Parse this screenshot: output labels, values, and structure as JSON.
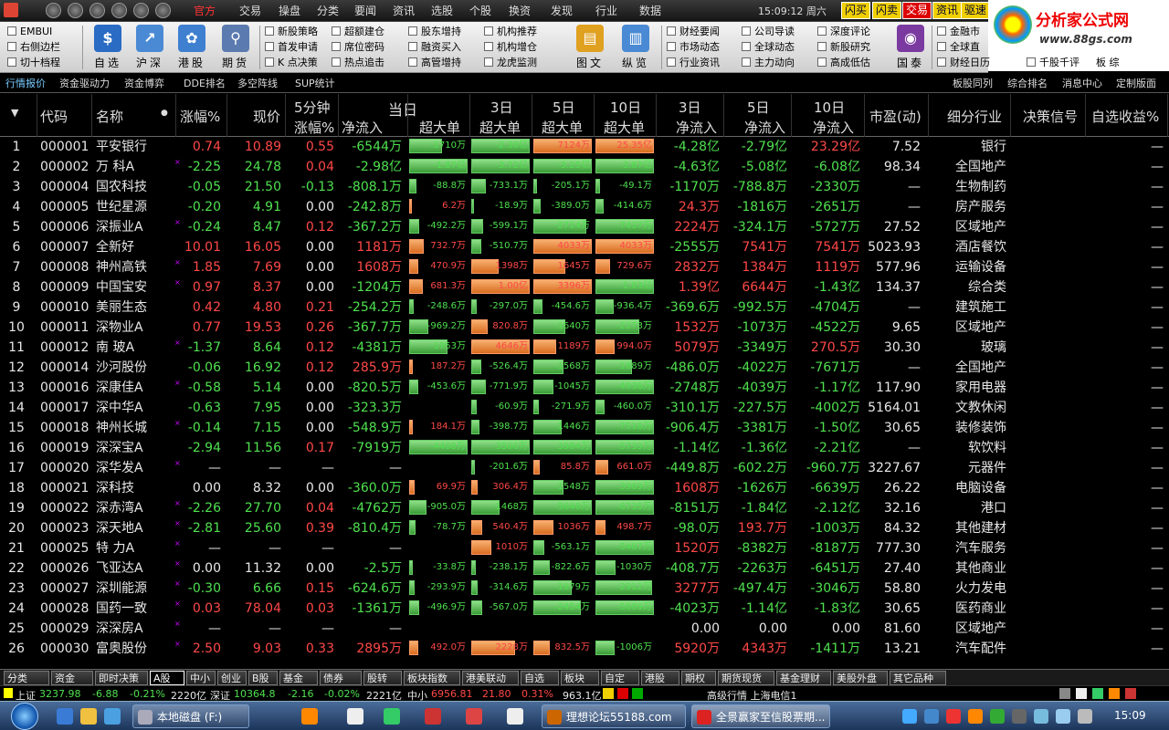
{
  "menubar": {
    "items": [
      "官方",
      "交易",
      "操盘",
      "分类",
      "要闻",
      "资讯",
      "选股",
      "个股",
      "换资",
      "发现",
      "行业",
      "数据"
    ],
    "time": "15:09:12",
    "weekday": "周六",
    "buttons": [
      "闪买",
      "闪卖",
      "交易",
      "资讯",
      "驱速"
    ]
  },
  "logo": {
    "title": "分析家公式网",
    "url": "www.88gs.com"
  },
  "toolbar": {
    "checks_left": [
      "EMBUI",
      "右侧边栏",
      "切十档程"
    ],
    "big_left": [
      {
        "icon": "$",
        "label": "自选"
      },
      {
        "icon": "↗",
        "label": "沪深"
      },
      {
        "icon": "✿",
        "label": "港股"
      },
      {
        "icon": "⚲",
        "label": "期货"
      }
    ],
    "check_cols": [
      [
        "新股策略",
        "首发申请",
        "K 点决策"
      ],
      [
        "超额建仓",
        "席位密码",
        "热点追击"
      ],
      [
        "股东增持",
        "融资买入",
        "高管增持"
      ],
      [
        "机构推荐",
        "机构增仓",
        "龙虎监测"
      ]
    ],
    "big_mid": [
      {
        "icon": "▤",
        "label": "图文"
      },
      {
        "icon": "▥",
        "label": "纵览"
      }
    ],
    "check_cols2": [
      [
        "财经要闻",
        "市场动态",
        "行业资讯"
      ],
      [
        "公司导读",
        "全球动态",
        "主力动向"
      ],
      [
        "深度评论",
        "新股研究",
        "高成低估"
      ]
    ],
    "big_right": {
      "icon": "◉",
      "label": "国泰"
    },
    "check_cols3": [
      [
        "金融市",
        "全球直",
        "财经日历"
      ],
      [
        "",
        "",
        "千股千评"
      ]
    ],
    "tail": "板 综"
  },
  "subtabs": [
    "行情报价",
    "资金驱动力",
    "资金博弈",
    "DDE排名",
    "多空阵线",
    "SUP统计"
  ],
  "subtabs_right": [
    "板股同列",
    "综合排名",
    "消息中心",
    "定制版面"
  ],
  "header": {
    "code": "代码",
    "name": "名称",
    "chg": "涨幅%",
    "price": "现价",
    "min5_top": "5分钟",
    "min5_bot": "涨幅%",
    "today": "当日",
    "d3": "3日",
    "d5": "5日",
    "d10": "10日",
    "netin": "净流入",
    "huge": "超大单",
    "pe": "市盈(动)",
    "industry": "细分行业",
    "signal": "决策信号",
    "selfgain": "自选收益%"
  },
  "stocks": [
    {
      "no": "1",
      "code": "000001",
      "name": "平安银行",
      "mark": "",
      "chg": "0.74",
      "price": "10.89",
      "m5": "0.55",
      "netin": "-6544万",
      "b1": "-1710万",
      "b2": "-2.30亿",
      "b3": "7124万",
      "b4": "25.35亿",
      "n3": "-4.28亿",
      "n5": "-2.79亿",
      "n10": "23.29亿",
      "pe": "7.52",
      "ind": "银行",
      "sg": "—"
    },
    {
      "no": "2",
      "code": "000002",
      "name": "万 科A",
      "mark": "×",
      "chg": "-2.25",
      "price": "24.78",
      "m5": "0.04",
      "netin": "-2.98亿",
      "b1": "-1.87亿",
      "b2": "-3.72亿",
      "b3": "-3.25亿",
      "b4": "-3.87亿",
      "n3": "-4.63亿",
      "n5": "-5.08亿",
      "n10": "-6.08亿",
      "pe": "98.34",
      "ind": "全国地产",
      "sg": "—"
    },
    {
      "no": "3",
      "code": "000004",
      "name": "国农科技",
      "mark": "",
      "chg": "-0.05",
      "price": "21.50",
      "m5": "-0.13",
      "netin": "-808.1万",
      "b1": "-88.8万",
      "b2": "-733.1万",
      "b3": "-205.1万",
      "b4": "-49.1万",
      "n3": "-1170万",
      "n5": "-788.8万",
      "n10": "-2330万",
      "pe": "—",
      "ind": "生物制药",
      "sg": "—"
    },
    {
      "no": "4",
      "code": "000005",
      "name": "世纪星源",
      "mark": "",
      "chg": "-0.20",
      "price": "4.91",
      "m5": "0.00",
      "netin": "-242.8万",
      "b1": "6.2万",
      "b2": "-18.9万",
      "b3": "-389.0万",
      "b4": "-414.6万",
      "n3": "24.3万",
      "n5": "-1816万",
      "n10": "-2651万",
      "pe": "—",
      "ind": "房产服务",
      "sg": "—"
    },
    {
      "no": "5",
      "code": "000006",
      "name": "深振业A",
      "mark": "×",
      "chg": "-0.24",
      "price": "8.47",
      "m5": "0.12",
      "netin": "-367.2万",
      "b1": "-492.2万",
      "b2": "-599.1万",
      "b3": "-2714万",
      "b4": "-7437万",
      "n3": "2224万",
      "n5": "-324.1万",
      "n10": "-5727万",
      "pe": "27.52",
      "ind": "区域地产",
      "sg": "—"
    },
    {
      "no": "6",
      "code": "000007",
      "name": "全新好",
      "mark": "",
      "chg": "10.01",
      "price": "16.05",
      "m5": "0.00",
      "netin": "1181万",
      "b1": "732.7万",
      "b2": "-510.7万",
      "b3": "4033万",
      "b4": "4033万",
      "n3": "-2555万",
      "n5": "7541万",
      "n10": "7541万",
      "pe": "5023.93",
      "ind": "酒店餐饮",
      "sg": "—"
    },
    {
      "no": "7",
      "code": "000008",
      "name": "神州高铁",
      "mark": "×",
      "chg": "1.85",
      "price": "7.69",
      "m5": "0.00",
      "netin": "1608万",
      "b1": "470.9万",
      "b2": "1398万",
      "b3": "1645万",
      "b4": "729.6万",
      "n3": "2832万",
      "n5": "1384万",
      "n10": "1119万",
      "pe": "577.96",
      "ind": "运输设备",
      "sg": "—"
    },
    {
      "no": "8",
      "code": "000009",
      "name": "中国宝安",
      "mark": "×",
      "chg": "0.97",
      "price": "8.37",
      "m5": "0.00",
      "netin": "-1204万",
      "b1": "681.3万",
      "b2": "1.00亿",
      "b3": "3396万",
      "b4": "-1.03亿",
      "n3": "1.39亿",
      "n5": "6644万",
      "n10": "-1.43亿",
      "pe": "134.37",
      "ind": "综合类",
      "sg": "—"
    },
    {
      "no": "9",
      "code": "000010",
      "name": "美丽生态",
      "mark": "",
      "chg": "0.42",
      "price": "4.80",
      "m5": "0.21",
      "netin": "-254.2万",
      "b1": "-248.6万",
      "b2": "-297.0万",
      "b3": "-454.6万",
      "b4": "-936.4万",
      "n3": "-369.6万",
      "n5": "-992.5万",
      "n10": "-4704万",
      "pe": "—",
      "ind": "建筑施工",
      "sg": "—"
    },
    {
      "no": "10",
      "code": "000011",
      "name": "深物业A",
      "mark": "",
      "chg": "0.77",
      "price": "19.53",
      "m5": "0.26",
      "netin": "-367.7万",
      "b1": "-969.2万",
      "b2": "820.8万",
      "b3": "-1640万",
      "b4": "-2273万",
      "n3": "1532万",
      "n5": "-1073万",
      "n10": "-4522万",
      "pe": "9.65",
      "ind": "区域地产",
      "sg": "—"
    },
    {
      "no": "11",
      "code": "000012",
      "name": "南 玻A",
      "mark": "×",
      "chg": "-1.37",
      "price": "8.64",
      "m5": "0.12",
      "netin": "-4381万",
      "b1": "-1953万",
      "b2": "4646万",
      "b3": "1189万",
      "b4": "994.0万",
      "n3": "5079万",
      "n5": "-3349万",
      "n10": "270.5万",
      "pe": "30.30",
      "ind": "玻璃",
      "sg": "—"
    },
    {
      "no": "12",
      "code": "000014",
      "name": "沙河股份",
      "mark": "",
      "chg": "-0.06",
      "price": "16.92",
      "m5": "0.12",
      "netin": "285.9万",
      "b1": "187.2万",
      "b2": "-526.4万",
      "b3": "-1568万",
      "b4": "-1889万",
      "n3": "-486.0万",
      "n5": "-4022万",
      "n10": "-7671万",
      "pe": "—",
      "ind": "全国地产",
      "sg": "—"
    },
    {
      "no": "13",
      "code": "000016",
      "name": "深康佳A",
      "mark": "×",
      "chg": "-0.58",
      "price": "5.14",
      "m5": "0.00",
      "netin": "-820.5万",
      "b1": "-453.6万",
      "b2": "-771.9万",
      "b3": "-1045万",
      "b4": "-4938万",
      "n3": "-2748万",
      "n5": "-4039万",
      "n10": "-1.17亿",
      "pe": "117.90",
      "ind": "家用电器",
      "sg": "—"
    },
    {
      "no": "14",
      "code": "000017",
      "name": "深中华A",
      "mark": "",
      "chg": "-0.63",
      "price": "7.95",
      "m5": "0.00",
      "netin": "-323.3万",
      "b1": "",
      "b2": "-60.9万",
      "b3": "-271.9万",
      "b4": "-460.0万",
      "n3": "-310.1万",
      "n5": "-227.5万",
      "n10": "-4002万",
      "pe": "5164.01",
      "ind": "文教休闲",
      "sg": "—"
    },
    {
      "no": "15",
      "code": "000018",
      "name": "神州长城",
      "mark": "×",
      "chg": "-0.14",
      "price": "7.15",
      "m5": "0.00",
      "netin": "-548.9万",
      "b1": "184.1万",
      "b2": "-398.7万",
      "b3": "-1446万",
      "b4": "-7518万",
      "n3": "-906.4万",
      "n5": "-3381万",
      "n10": "-1.50亿",
      "pe": "30.65",
      "ind": "装修装饰",
      "sg": "—"
    },
    {
      "no": "16",
      "code": "000019",
      "name": "深深宝A",
      "mark": "",
      "chg": "-2.94",
      "price": "11.56",
      "m5": "0.17",
      "netin": "-7919万",
      "b1": "-4408万",
      "b2": "-3500万",
      "b3": "-3984万",
      "b4": "-5739万",
      "n3": "-1.14亿",
      "n5": "-1.36亿",
      "n10": "-2.21亿",
      "pe": "—",
      "ind": "软饮料",
      "sg": "—"
    },
    {
      "no": "17",
      "code": "000020",
      "name": "深华发A",
      "mark": "×",
      "chg": "—",
      "price": "—",
      "m5": "—",
      "netin": "—",
      "b1": "",
      "b2": "-201.6万",
      "b3": "85.8万",
      "b4": "661.0万",
      "n3": "-449.8万",
      "n5": "-602.2万",
      "n10": "-960.7万",
      "pe": "3227.67",
      "ind": "元器件",
      "sg": "—"
    },
    {
      "no": "18",
      "code": "000021",
      "name": "深科技",
      "mark": "",
      "chg": "0.00",
      "price": "8.32",
      "m5": "0.00",
      "netin": "-360.0万",
      "b1": "69.9万",
      "b2": "306.4万",
      "b3": "-1548万",
      "b4": "-3909万",
      "n3": "1608万",
      "n5": "-1626万",
      "n10": "-6639万",
      "pe": "26.22",
      "ind": "电脑设备",
      "sg": "—"
    },
    {
      "no": "19",
      "code": "000022",
      "name": "深赤湾A",
      "mark": "×",
      "chg": "-2.26",
      "price": "27.70",
      "m5": "0.04",
      "netin": "-4762万",
      "b1": "-905.0万",
      "b2": "-1468万",
      "b3": "-5648万",
      "b4": "-6735万",
      "n3": "-8151万",
      "n5": "-1.84亿",
      "n10": "-2.12亿",
      "pe": "32.16",
      "ind": "港口",
      "sg": "—"
    },
    {
      "no": "20",
      "code": "000023",
      "name": "深天地A",
      "mark": "×",
      "chg": "-2.81",
      "price": "25.60",
      "m5": "0.39",
      "netin": "-810.4万",
      "b1": "-78.7万",
      "b2": "540.4万",
      "b3": "1036万",
      "b4": "498.7万",
      "n3": "-98.0万",
      "n5": "193.7万",
      "n10": "-1003万",
      "pe": "84.32",
      "ind": "其他建材",
      "sg": "—"
    },
    {
      "no": "21",
      "code": "000025",
      "name": "特 力A",
      "mark": "×",
      "chg": "—",
      "price": "—",
      "m5": "—",
      "netin": "—",
      "b1": "",
      "b2": "1010万",
      "b3": "-563.1万",
      "b4": "-5407万",
      "n3": "1520万",
      "n5": "-8382万",
      "n10": "-8187万",
      "pe": "777.30",
      "ind": "汽车服务",
      "sg": "—"
    },
    {
      "no": "22",
      "code": "000026",
      "name": "飞亚达A",
      "mark": "×",
      "chg": "0.00",
      "price": "11.32",
      "m5": "0.00",
      "netin": "-2.5万",
      "b1": "-33.8万",
      "b2": "-238.1万",
      "b3": "-822.6万",
      "b4": "-1030万",
      "n3": "-408.7万",
      "n5": "-2263万",
      "n10": "-6451万",
      "pe": "27.40",
      "ind": "其他商业",
      "sg": "—"
    },
    {
      "no": "23",
      "code": "000027",
      "name": "深圳能源",
      "mark": "×",
      "chg": "-0.30",
      "price": "6.66",
      "m5": "0.15",
      "netin": "-624.6万",
      "b1": "-293.9万",
      "b2": "-314.6万",
      "b3": "-1979万",
      "b4": "-2912万",
      "n3": "3277万",
      "n5": "-497.4万",
      "n10": "-3046万",
      "pe": "58.80",
      "ind": "火力发电",
      "sg": "—"
    },
    {
      "no": "24",
      "code": "000028",
      "name": "国药一致",
      "mark": "×",
      "chg": "0.03",
      "price": "78.04",
      "m5": "0.03",
      "netin": "-1361万",
      "b1": "-496.9万",
      "b2": "-567.0万",
      "b3": "-2454万",
      "b4": "-5609万",
      "n3": "-4023万",
      "n5": "-1.14亿",
      "n10": "-1.83亿",
      "pe": "30.65",
      "ind": "医药商业",
      "sg": "—"
    },
    {
      "no": "25",
      "code": "000029",
      "name": "深深房A",
      "mark": "×",
      "chg": "—",
      "price": "—",
      "m5": "—",
      "netin": "—",
      "b1": "",
      "b2": "",
      "b3": "",
      "b4": "",
      "n3": "0.00",
      "n5": "0.00",
      "n10": "0.00",
      "pe": "81.60",
      "ind": "区域地产",
      "sg": "—"
    },
    {
      "no": "26",
      "code": "000030",
      "name": "富奥股份",
      "mark": "×",
      "chg": "2.50",
      "price": "9.03",
      "m5": "0.33",
      "netin": "2895万",
      "b1": "492.0万",
      "b2": "2228万",
      "b3": "832.5万",
      "b4": "-1006万",
      "n3": "5920万",
      "n5": "4343万",
      "n10": "-1411万",
      "pe": "13.21",
      "ind": "汽车配件",
      "sg": "—"
    }
  ],
  "bottom_tabs": [
    "分类",
    "资金",
    "即时决策",
    "A股",
    "中小",
    "创业",
    "B股",
    "基金",
    "债券",
    "股转",
    "板块指数",
    "港美联动",
    "自选",
    "板块",
    "自定",
    "港股",
    "期权",
    "期货现货",
    "基金理财",
    "美股外盘",
    "其它品种"
  ],
  "active_bottom_tab": "A股",
  "status": {
    "sh_label": "上证",
    "sh_idx": "3237.98",
    "sh_chg": "-6.88",
    "sh_pct": "-0.21%",
    "sh_amt": "2220亿",
    "sz_label": "深证",
    "sz_idx": "10364.8",
    "sz_chg": "-2.16",
    "sz_pct": "-0.02%",
    "sz_amt": "2221亿",
    "zx_label": "中小",
    "zx_idx": "6956.81",
    "zx_chg": "21.80",
    "zx_pct": "0.31%",
    "zx_amt": "963.1亿",
    "feed": "高级行情 上海电信1"
  },
  "taskbar": {
    "tasks": [
      "本地磁盘 (F:)",
      "理想论坛55188.com",
      "全景赢家至信股票期..."
    ],
    "time": "15:09"
  },
  "colors": {
    "up": "#ff4848",
    "down": "#4fe14f",
    "bar_green": "#4cad46",
    "bar_orange": "#e2782a",
    "accent_yellow": "#f0d000"
  }
}
